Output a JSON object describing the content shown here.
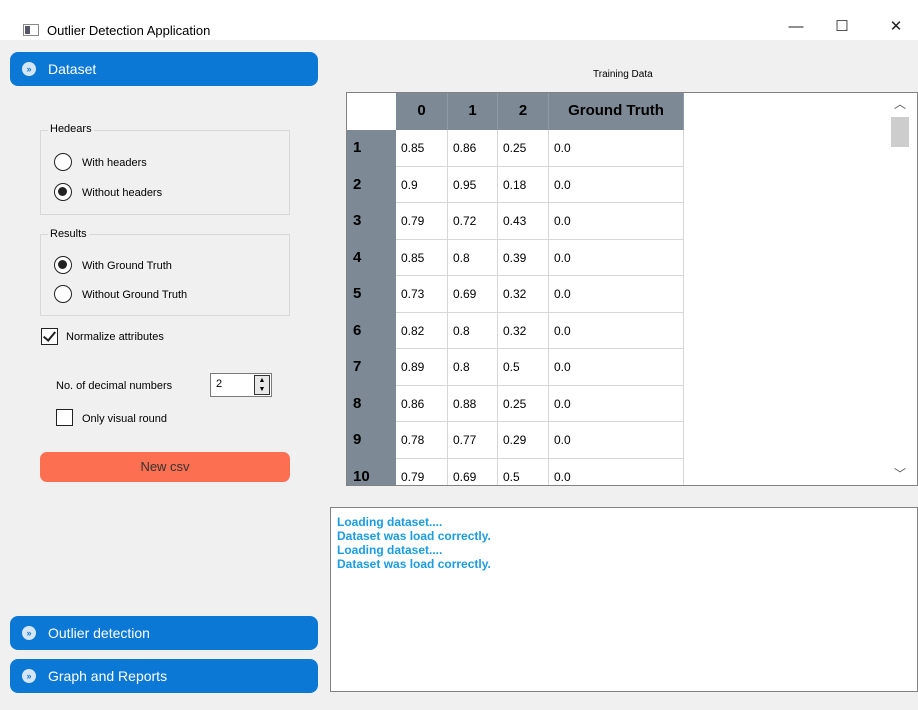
{
  "window": {
    "title": "Outlier Detection Application",
    "minimize": "—",
    "maximize": "☐",
    "close": "✕"
  },
  "sections": {
    "dataset": "Dataset",
    "outlier_detection": "Outlier detection",
    "graph_reports": "Graph and Reports"
  },
  "headers_group": {
    "title": "Hedears",
    "options": [
      "With headers",
      "Without headers"
    ],
    "selected": "Without headers"
  },
  "results_group": {
    "title": "Results",
    "options": [
      "With Ground Truth",
      "Without Ground Truth"
    ],
    "selected": "With Ground Truth"
  },
  "normalize": {
    "label": "Normalize attributes",
    "checked": true
  },
  "decimals": {
    "label": "No. of decimal numbers",
    "value": "2"
  },
  "visual_round": {
    "label": "Only visual round",
    "checked": false
  },
  "new_csv_label": "New csv",
  "table": {
    "caption": "Training Data",
    "columns": [
      "0",
      "1",
      "2",
      "Ground Truth"
    ],
    "rows": [
      {
        "id": "1",
        "cells": [
          "0.85",
          "0.86",
          "0.25",
          "0.0"
        ]
      },
      {
        "id": "2",
        "cells": [
          "0.9",
          "0.95",
          "0.18",
          "0.0"
        ]
      },
      {
        "id": "3",
        "cells": [
          "0.79",
          "0.72",
          "0.43",
          "0.0"
        ]
      },
      {
        "id": "4",
        "cells": [
          "0.85",
          "0.8",
          "0.39",
          "0.0"
        ]
      },
      {
        "id": "5",
        "cells": [
          "0.73",
          "0.69",
          "0.32",
          "0.0"
        ]
      },
      {
        "id": "6",
        "cells": [
          "0.82",
          "0.8",
          "0.32",
          "0.0"
        ]
      },
      {
        "id": "7",
        "cells": [
          "0.89",
          "0.8",
          "0.5",
          "0.0"
        ]
      },
      {
        "id": "8",
        "cells": [
          "0.86",
          "0.88",
          "0.25",
          "0.0"
        ]
      },
      {
        "id": "9",
        "cells": [
          "0.78",
          "0.77",
          "0.29",
          "0.0"
        ]
      },
      {
        "id": "10",
        "cells": [
          "0.79",
          "0.69",
          "0.5",
          "0.0"
        ]
      }
    ]
  },
  "log": [
    "Loading dataset....",
    "Dataset was load correctly.",
    "Loading dataset....",
    "Dataset was load correctly."
  ],
  "colors": {
    "accent": "#0a78d4",
    "button": "#fd6f51",
    "log_text": "#1a9ce0",
    "header_bg": "#7d8995"
  }
}
